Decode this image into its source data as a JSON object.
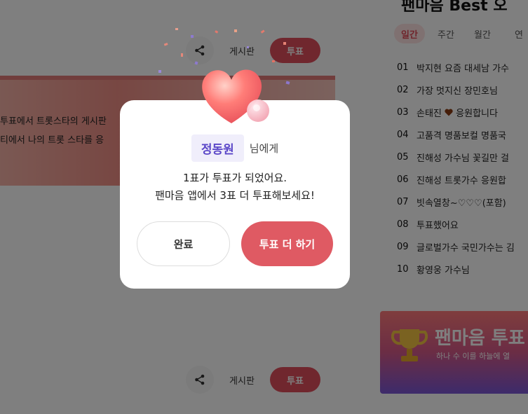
{
  "board": {
    "title": "팬마음 Best 오",
    "tabs": [
      {
        "label": "일간",
        "active": true
      },
      {
        "label": "주간",
        "active": false
      },
      {
        "label": "월간",
        "active": false
      },
      {
        "label": "연",
        "active": false
      }
    ],
    "ranks": [
      {
        "num": "01",
        "text": "박지현 요즘 대세남 가수"
      },
      {
        "num": "02",
        "text": "가장 멋지신 장민호님"
      },
      {
        "num": "03",
        "text": "손태진",
        "suffix": "응원합니다",
        "heart": true
      },
      {
        "num": "04",
        "text": "고품격 명품보컬 명품국"
      },
      {
        "num": "05",
        "text": "진해성 가수님 꽃길만 걸"
      },
      {
        "num": "06",
        "text": "진해성 트롯가수 응원합"
      },
      {
        "num": "07",
        "text": "빗속열창~♡♡♡(포함)"
      },
      {
        "num": "08",
        "text": "투표했어요"
      },
      {
        "num": "09",
        "text": "글로벌가수 국민가수는 김"
      },
      {
        "num": "10",
        "text": "황영웅 가수님"
      }
    ]
  },
  "actions": {
    "board_label": "게시판",
    "vote_label": "투표"
  },
  "banner": {
    "line1": "투표에서 트롯스타의 게시판",
    "line2": "티에서 나의 트롯 스타를 응"
  },
  "promo": {
    "title": "팬마음 투표",
    "subtitle": "하나 수 이를 하늘에 열"
  },
  "modal": {
    "recipient": "정동원",
    "recipient_suffix": "님에게",
    "message_line1": "1표가 투표가 되었어요.",
    "message_line2": "팬마음 앱에서 3표 더 투표해보세요!",
    "done_label": "완료",
    "more_label": "투표 더 하기"
  },
  "colors": {
    "accent": "#df5a63",
    "recipient": "#5b47c8",
    "overlay": "rgba(0,0,0,0.5)"
  }
}
